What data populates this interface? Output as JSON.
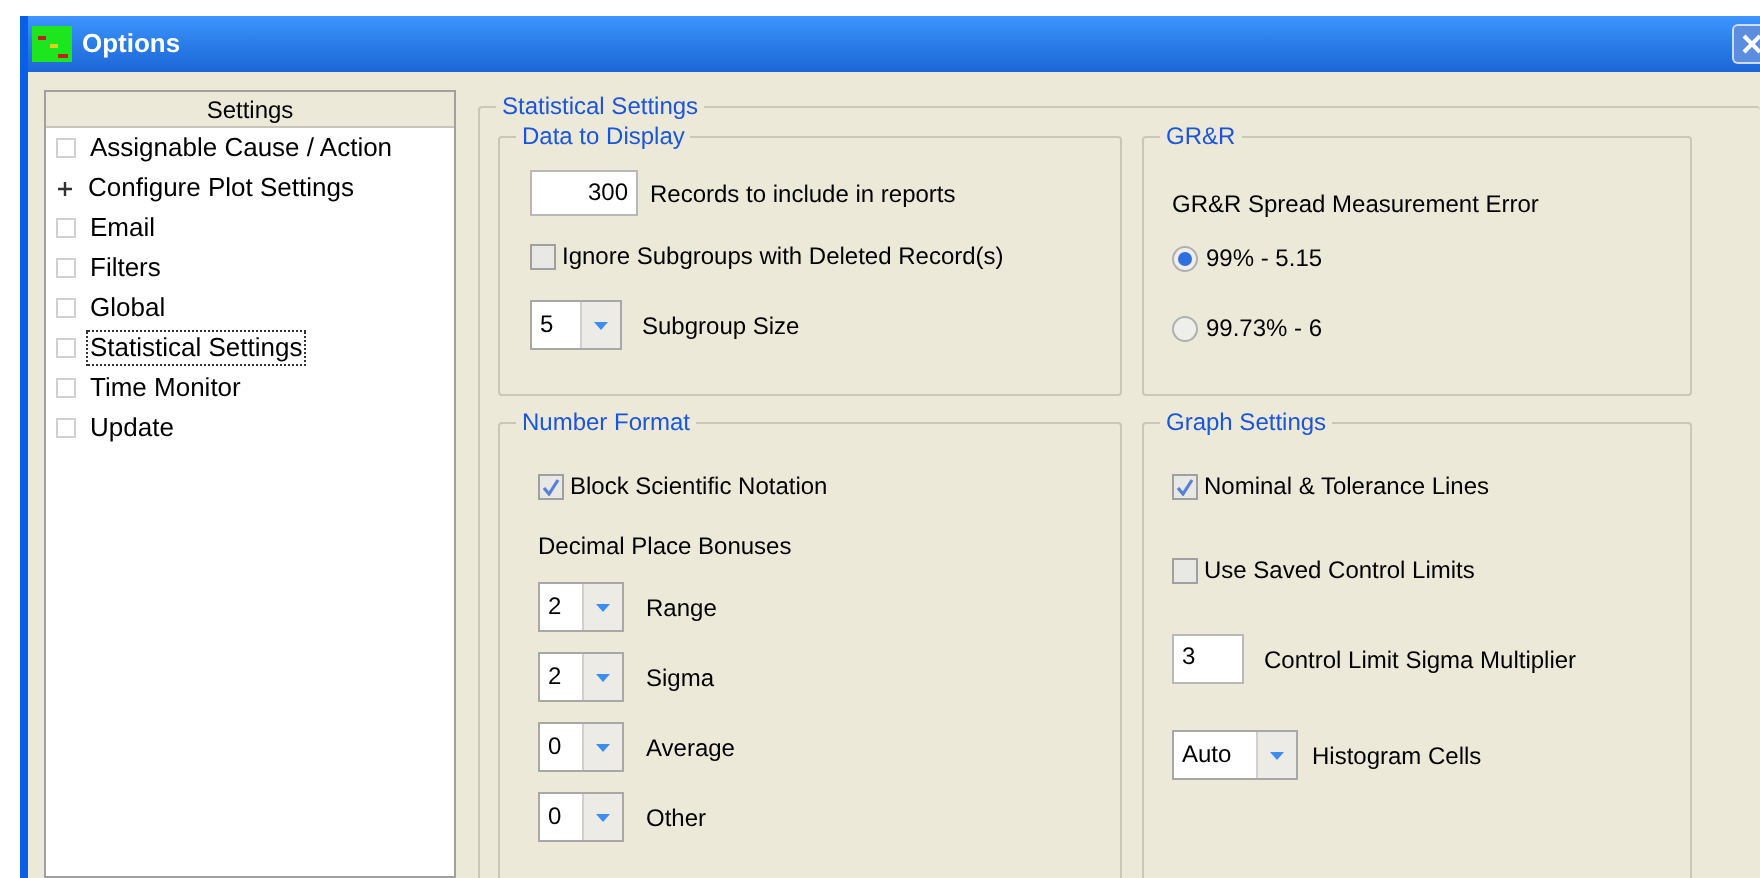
{
  "window": {
    "title": "Options"
  },
  "tree": {
    "header": "Settings",
    "items": [
      {
        "label": "Assignable Cause / Action",
        "kind": "leaf",
        "selected": false
      },
      {
        "label": "Configure Plot Settings",
        "kind": "folder",
        "selected": false
      },
      {
        "label": "Email",
        "kind": "leaf",
        "selected": false
      },
      {
        "label": "Filters",
        "kind": "leaf",
        "selected": false
      },
      {
        "label": "Global",
        "kind": "leaf",
        "selected": false
      },
      {
        "label": "Statistical Settings",
        "kind": "leaf",
        "selected": true
      },
      {
        "label": "Time Monitor",
        "kind": "leaf",
        "selected": false
      },
      {
        "label": "Update",
        "kind": "leaf",
        "selected": false
      }
    ]
  },
  "panel": {
    "title": "Statistical Settings",
    "data_to_display": {
      "title": "Data to Display",
      "records": {
        "value": "300",
        "label": "Records to include in reports"
      },
      "ignore_subgroups": {
        "label": "Ignore Subgroups with Deleted Record(s)",
        "checked": false
      },
      "subgroup_size": {
        "value": "5",
        "label": "Subgroup Size"
      }
    },
    "grr": {
      "title": "GR&R",
      "label": "GR&R Spread Measurement Error",
      "options": [
        {
          "label": "99% - 5.15",
          "selected": true
        },
        {
          "label": "99.73% - 6",
          "selected": false
        }
      ]
    },
    "number_format": {
      "title": "Number Format",
      "block_scientific": {
        "label": "Block Scientific Notation",
        "checked": true
      },
      "bonuses_label": "Decimal Place Bonuses",
      "bonuses": [
        {
          "value": "2",
          "label": "Range"
        },
        {
          "value": "2",
          "label": "Sigma"
        },
        {
          "value": "0",
          "label": "Average"
        },
        {
          "value": "0",
          "label": "Other"
        }
      ]
    },
    "graph_settings": {
      "title": "Graph Settings",
      "nominal_lines": {
        "label": "Nominal & Tolerance Lines",
        "checked": true
      },
      "saved_limits": {
        "label": "Use Saved Control Limits",
        "checked": false
      },
      "sigma_multiplier": {
        "value": "3",
        "label": "Control Limit Sigma Multiplier"
      },
      "histogram_cells": {
        "value": "Auto",
        "label": "Histogram Cells"
      }
    }
  }
}
